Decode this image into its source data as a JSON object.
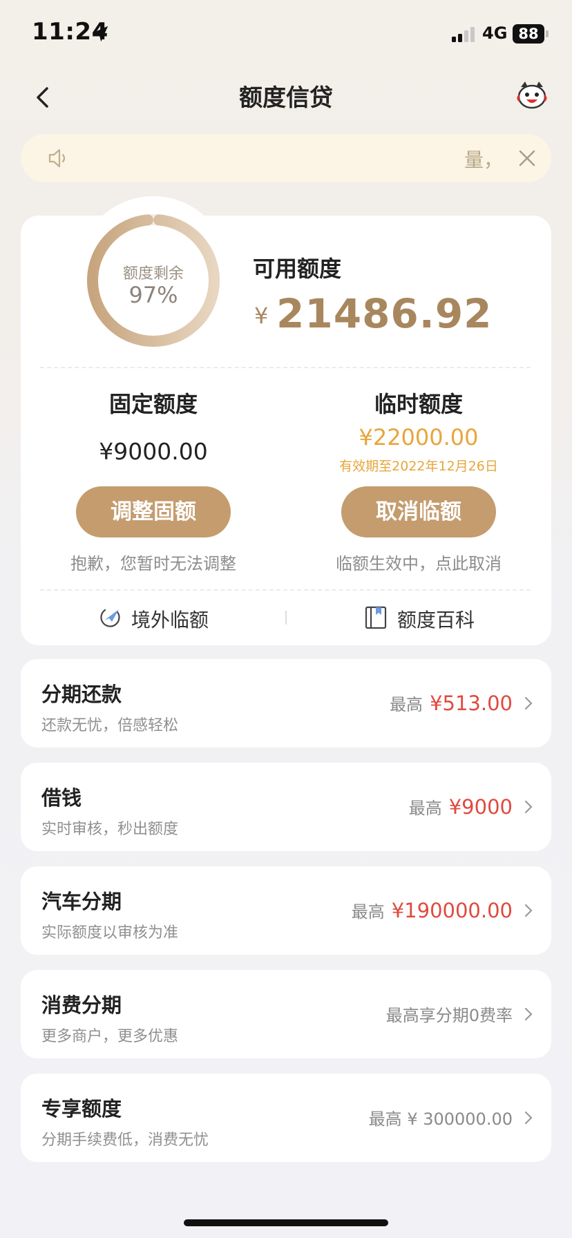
{
  "status_bar": {
    "time": "11:24",
    "network": "4G",
    "battery": "88"
  },
  "nav": {
    "title": "额度信贷"
  },
  "notice": {
    "text": "量，"
  },
  "credit": {
    "ring_label": "额度剩余",
    "remaining_percent": "97%",
    "remaining_fraction": 0.97,
    "available_label": "可用额度",
    "currency": "¥",
    "available_value": "21486.92"
  },
  "fixed": {
    "title": "固定额度",
    "amount": "¥9000.00",
    "button": "调整固额",
    "note": "抱歉，您暂时无法调整"
  },
  "temp": {
    "title": "临时额度",
    "amount": "¥22000.00",
    "valid_until": "有效期至2022年12月26日",
    "button": "取消临额",
    "note": "临额生效中，点此取消"
  },
  "links": {
    "overseas": "境外临额",
    "wiki": "额度百科"
  },
  "list": [
    {
      "title": "分期还款",
      "sub": "还款无忧，倍感轻松",
      "prefix": "最高",
      "amount": "¥513.00"
    },
    {
      "title": "借钱",
      "sub": "实时审核，秒出额度",
      "prefix": "最高",
      "amount": "¥9000"
    },
    {
      "title": "汽车分期",
      "sub": "实际额度以审核为准",
      "prefix": "最高",
      "amount": "¥190000.00"
    },
    {
      "title": "消费分期",
      "sub": "更多商户，更多优惠",
      "prefix": "最高享分期0费率",
      "amount": ""
    },
    {
      "title": "专享额度",
      "sub": "分期手续费低，消费无忧",
      "prefix": "最高 ¥ 300000.00",
      "amount": ""
    }
  ],
  "colors": {
    "gold": "#c49c6e",
    "gold_text": "#a8875e",
    "orange": "#e8a53a",
    "red": "#e04a3f"
  }
}
